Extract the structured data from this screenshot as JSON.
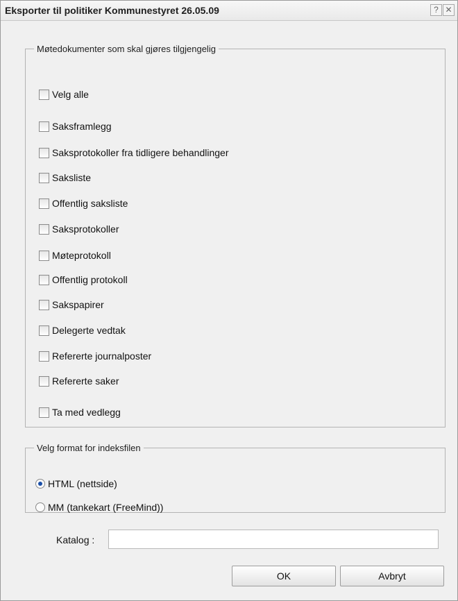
{
  "window": {
    "title": "Eksporter til politiker Kommunestyret 26.05.09",
    "help_glyph": "?",
    "close_glyph": "✕"
  },
  "documents_group": {
    "legend": "Møtedokumenter som skal gjøres tilgjengelig",
    "select_all": {
      "label": "Velg alle",
      "checked": false
    },
    "items": [
      {
        "label": "Saksframlegg",
        "checked": false
      },
      {
        "label": "Saksprotokoller fra tidligere behandlinger",
        "checked": false
      },
      {
        "label": "Saksliste",
        "checked": false
      },
      {
        "label": "Offentlig saksliste",
        "checked": false
      },
      {
        "label": "Saksprotokoller",
        "checked": false
      },
      {
        "label": "Møteprotokoll",
        "checked": false
      },
      {
        "label": "Offentlig protokoll",
        "checked": false
      },
      {
        "label": "Sakspapirer",
        "checked": false
      },
      {
        "label": "Delegerte vedtak",
        "checked": false
      },
      {
        "label": "Refererte journalposter",
        "checked": false
      },
      {
        "label": "Refererte saker",
        "checked": false
      }
    ],
    "include_attachments": {
      "label": "Ta med vedlegg",
      "checked": false
    }
  },
  "format_group": {
    "legend": "Velg format for indeksfilen",
    "options": [
      {
        "label": "HTML (nettside)",
        "selected": true
      },
      {
        "label": "MM (tankekart (FreeMind))",
        "selected": false
      }
    ]
  },
  "katalog": {
    "label": "Katalog :",
    "value": ""
  },
  "buttons": {
    "ok": "OK",
    "cancel": "Avbryt"
  }
}
